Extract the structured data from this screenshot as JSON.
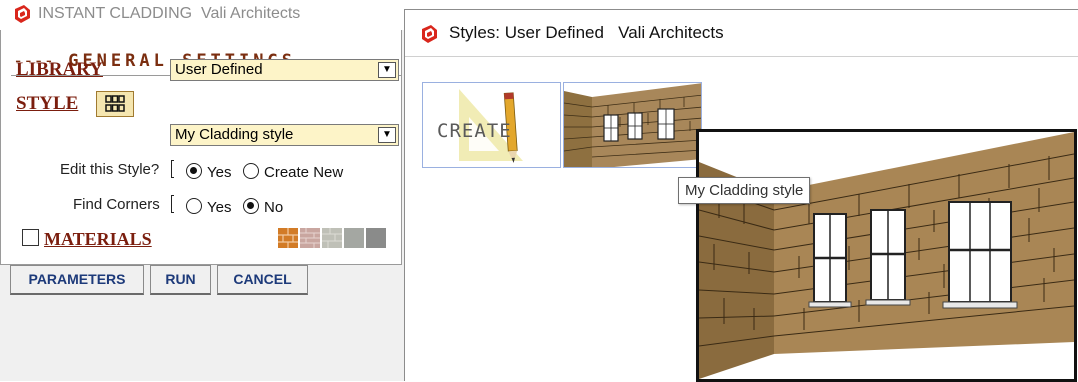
{
  "left_window": {
    "title_app": "INSTANT CLADDING",
    "title_company": "Vali Architects",
    "heading": "GENERAL SETTINGS",
    "heading_left_dashes": "----",
    "heading_right_dashes": "-----",
    "library_label": "LIBRARY",
    "library_value": "User Defined",
    "style_label": "STYLE",
    "style_value": "My Cladding style",
    "edit_style_label": "Edit this Style?",
    "edit_options": [
      "Yes",
      "Create New"
    ],
    "edit_selected": "Yes",
    "find_corners_label": "Find Corners",
    "corner_options": [
      "Yes",
      "No"
    ],
    "corner_selected": "No",
    "materials_label": "MATERIALS",
    "materials_checked": false,
    "material_swatch_colors": [
      "#d27b26",
      "#c9a6a0",
      "#bfc0b7",
      "#a4a7a2",
      "#8a8b8a"
    ],
    "buttons": {
      "parameters": "PARAMETERS",
      "run": "RUN",
      "cancel": "CANCEL"
    }
  },
  "right_window": {
    "title_app": "Styles: User Defined",
    "title_company": "Vali Architects",
    "thumbnails": [
      {
        "label": "CREATE",
        "kind": "create-new-icon"
      },
      {
        "label": "",
        "kind": "cladding-style-thumbnail"
      }
    ],
    "tooltip": "My Cladding style"
  },
  "colors": {
    "brand_red": "#d9261c",
    "label_maroon": "#7b1e0e",
    "select_bg": "#fdf4c8",
    "button_text": "#1d3a7a",
    "stone": "#9c7d4e"
  }
}
